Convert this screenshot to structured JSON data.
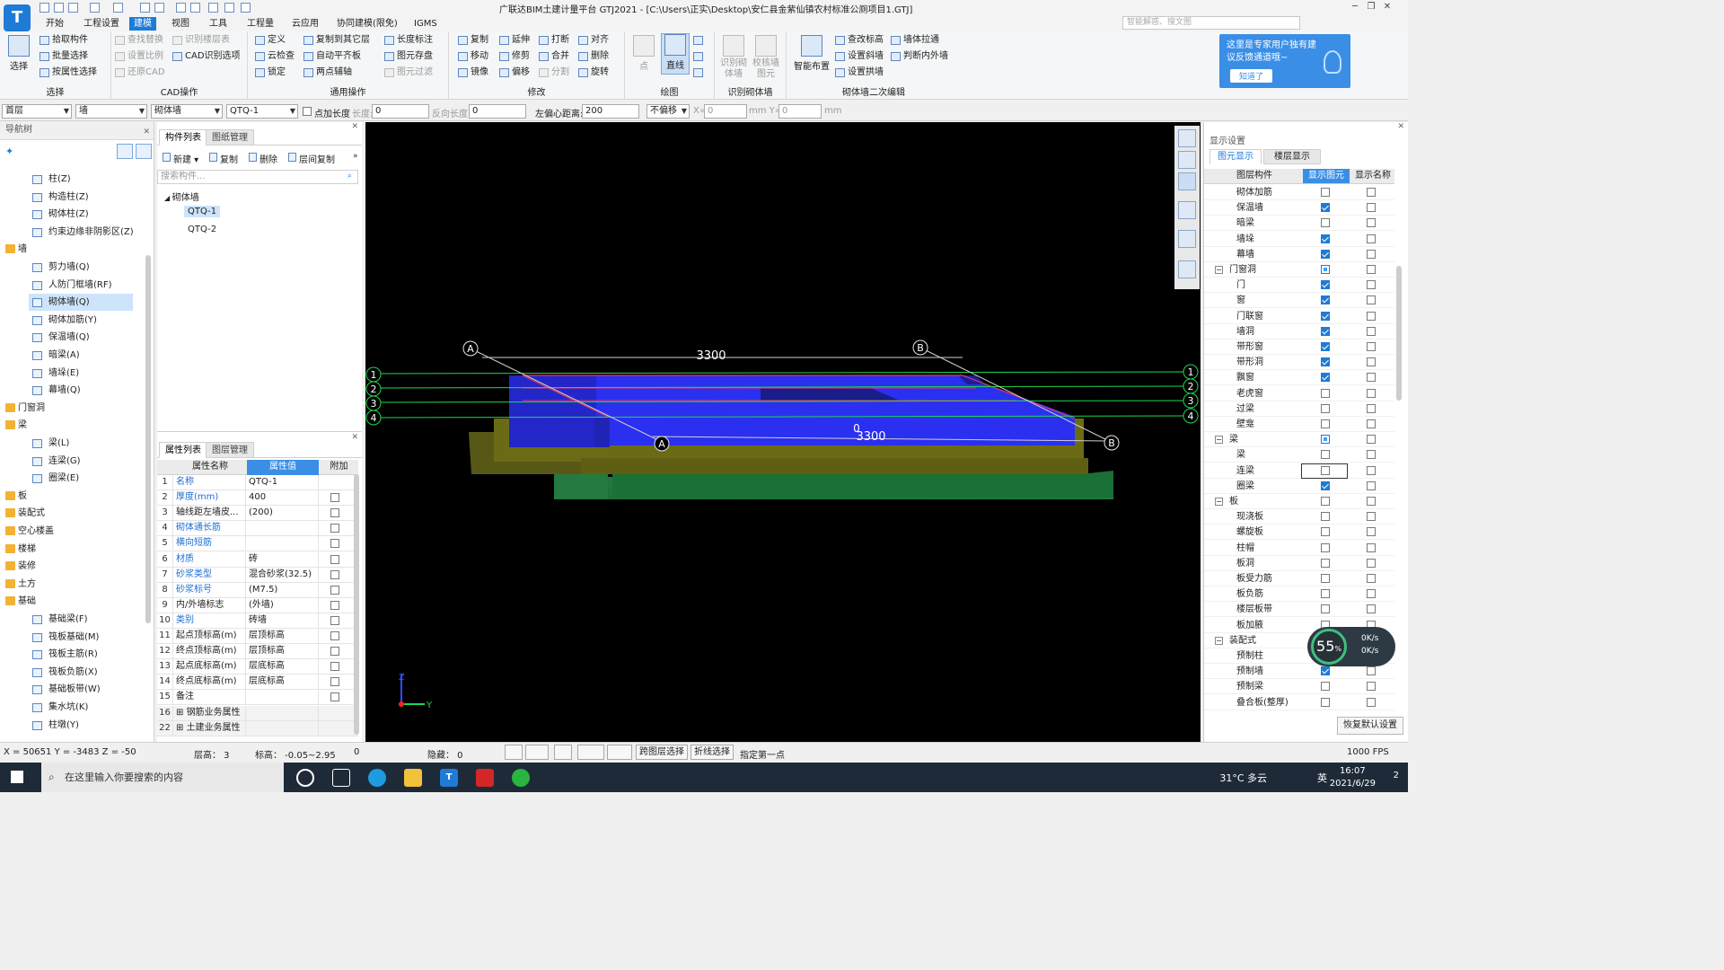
{
  "title": "广联达BIM土建计量平台 GTJ2021 - [C:\\Users\\正实\\Desktop\\安仁县金紫仙镇农村标准公厕项目1.GTJ]",
  "logo": "T",
  "menu": [
    "开始",
    "工程设置",
    "建模",
    "视图",
    "工具",
    "工程量",
    "云应用",
    "协同建模(限免)",
    "IGMS"
  ],
  "search_placeholder": "智能解惑、搜文图",
  "ribbon": {
    "select": {
      "big": "选择",
      "items": [
        "拾取构件",
        "批量选择",
        "按属性选择"
      ],
      "label": "选择"
    },
    "cad": {
      "items": [
        "查找替换",
        "设置比例",
        "还原CAD",
        "识别楼层表",
        "CAD识别选项"
      ],
      "label": "CAD操作"
    },
    "general": {
      "items": [
        "定义",
        "云检查",
        "锁定",
        "复制到其它层",
        "自动平齐板",
        "两点辅轴",
        "长度标注",
        "图元存盘",
        "图元过滤"
      ],
      "label": "通用操作"
    },
    "modify": {
      "items": [
        "复制",
        "移动",
        "镜像",
        "延伸",
        "修剪",
        "偏移",
        "打断",
        "合并",
        "分割",
        "对齐",
        "删除",
        "旋转"
      ],
      "label": "修改"
    },
    "draw": {
      "items": [
        "点",
        "直线"
      ],
      "label": "绘图"
    },
    "recognize": {
      "items": [
        "识别砌体墙",
        "校核墙图元"
      ],
      "label": "识别砌体墙"
    },
    "second_edit": {
      "items": [
        "智能布置",
        "查改标高",
        "设置斜墙",
        "设置拱墙",
        "墙体拉通",
        "判断内外墙"
      ],
      "label": "砌体墙二次编辑"
    }
  },
  "tip": {
    "text": "这里是专家用户独有建议反馈通道哦~",
    "button": "知道了"
  },
  "toolbar2": {
    "floor": "首层",
    "category": "墙",
    "type": "砌体墙",
    "component": "QTQ-1",
    "add_length_label": "点加长度",
    "length_label": "长度:",
    "length_value": "0",
    "reverse_label": "反向长度:",
    "reverse_value": "0",
    "offset_label": "左偏心距离:",
    "offset_value": "200",
    "mode": "不偏移",
    "x_label": "X=",
    "x_value": "0",
    "mm_y": "mm Y=",
    "y_value": "0",
    "mm": "mm"
  },
  "nav": {
    "title": "导航树",
    "rows": [
      {
        "label": "柱(Z)",
        "group": false
      },
      {
        "label": "构造柱(Z)",
        "group": false
      },
      {
        "label": "砌体柱(Z)",
        "group": false
      },
      {
        "label": "约束边缘非阴影区(Z)",
        "group": false
      },
      {
        "label": "墙",
        "group": true
      },
      {
        "label": "剪力墙(Q)",
        "group": false
      },
      {
        "label": "人防门框墙(RF)",
        "group": false
      },
      {
        "label": "砌体墙(Q)",
        "group": false,
        "selected": true
      },
      {
        "label": "砌体加筋(Y)",
        "group": false
      },
      {
        "label": "保温墙(Q)",
        "group": false
      },
      {
        "label": "暗梁(A)",
        "group": false
      },
      {
        "label": "墙垛(E)",
        "group": false
      },
      {
        "label": "幕墙(Q)",
        "group": false
      },
      {
        "label": "门窗洞",
        "group": true
      },
      {
        "label": "梁",
        "group": true
      },
      {
        "label": "梁(L)",
        "group": false
      },
      {
        "label": "连梁(G)",
        "group": false
      },
      {
        "label": "圈梁(E)",
        "group": false
      },
      {
        "label": "板",
        "group": true
      },
      {
        "label": "装配式",
        "group": true
      },
      {
        "label": "空心楼盖",
        "group": true
      },
      {
        "label": "楼梯",
        "group": true
      },
      {
        "label": "装修",
        "group": true
      },
      {
        "label": "土方",
        "group": true
      },
      {
        "label": "基础",
        "group": true
      },
      {
        "label": "基础梁(F)",
        "group": false
      },
      {
        "label": "筏板基础(M)",
        "group": false
      },
      {
        "label": "筏板主筋(R)",
        "group": false
      },
      {
        "label": "筏板负筋(X)",
        "group": false
      },
      {
        "label": "基础板带(W)",
        "group": false
      },
      {
        "label": "集水坑(K)",
        "group": false
      },
      {
        "label": "柱墩(Y)",
        "group": false
      }
    ]
  },
  "component_list": {
    "tabs": [
      "构件列表",
      "图纸管理"
    ],
    "toolbar": [
      "新建",
      "复制",
      "删除",
      "层间复制"
    ],
    "search_placeholder": "搜索构件...",
    "root": "砌体墙",
    "items": [
      "QTQ-1",
      "QTQ-2"
    ]
  },
  "property_list": {
    "tabs": [
      "属性列表",
      "图层管理"
    ],
    "headers": [
      "属性名称",
      "属性值",
      "附加"
    ],
    "rows": [
      {
        "idx": "1",
        "name": "名称",
        "value": "QTQ-1",
        "blue": true,
        "check": false
      },
      {
        "idx": "2",
        "name": "厚度(mm)",
        "value": "400",
        "blue": true,
        "check": true
      },
      {
        "idx": "3",
        "name": "轴线距左墙皮...",
        "value": "(200)",
        "blue": false,
        "check": true
      },
      {
        "idx": "4",
        "name": "砌体通长筋",
        "value": "",
        "blue": true,
        "check": true
      },
      {
        "idx": "5",
        "name": "横向短筋",
        "value": "",
        "blue": true,
        "check": true
      },
      {
        "idx": "6",
        "name": "材质",
        "value": "砖",
        "blue": true,
        "check": true
      },
      {
        "idx": "7",
        "name": "砂浆类型",
        "value": "混合砂浆(32.5)",
        "blue": true,
        "check": true
      },
      {
        "idx": "8",
        "name": "砂浆标号",
        "value": "(M7.5)",
        "blue": true,
        "check": true
      },
      {
        "idx": "9",
        "name": "内/外墙标志",
        "value": "(外墙)",
        "blue": false,
        "check": true
      },
      {
        "idx": "10",
        "name": "类别",
        "value": "砖墙",
        "blue": true,
        "check": true
      },
      {
        "idx": "11",
        "name": "起点顶标高(m)",
        "value": "层顶标高",
        "blue": false,
        "check": true
      },
      {
        "idx": "12",
        "name": "终点顶标高(m)",
        "value": "层顶标高",
        "blue": false,
        "check": true
      },
      {
        "idx": "13",
        "name": "起点底标高(m)",
        "value": "层底标高",
        "blue": false,
        "check": true
      },
      {
        "idx": "14",
        "name": "终点底标高(m)",
        "value": "层底标高",
        "blue": false,
        "check": true
      },
      {
        "idx": "15",
        "name": "备注",
        "value": "",
        "blue": false,
        "check": true
      },
      {
        "idx": "16",
        "name": "钢筋业务属性",
        "value": "",
        "blue": false,
        "check": false,
        "group": true
      },
      {
        "idx": "22",
        "name": "土建业务属性",
        "value": "",
        "blue": false,
        "check": false,
        "group": true
      }
    ]
  },
  "viewport": {
    "dim_top": "3300",
    "dim_bottom": "3300",
    "zero": "0",
    "axis_letters": [
      "A",
      "B",
      "A",
      "B"
    ],
    "axis_numbers": [
      "1",
      "2",
      "3",
      "4"
    ],
    "axis_x": "Y",
    "axis_z": "Z"
  },
  "display": {
    "title": "显示设置",
    "tabs": [
      "图元显示",
      "楼层显示"
    ],
    "headers": [
      "图层构件",
      "显示图元",
      "显示名称"
    ],
    "rows": [
      {
        "name": "砌体加筋",
        "level": 1,
        "show": "off",
        "name_show": false
      },
      {
        "name": "保温墙",
        "level": 1,
        "show": "on",
        "name_show": false
      },
      {
        "name": "暗梁",
        "level": 1,
        "show": "off",
        "name_show": false
      },
      {
        "name": "墙垛",
        "level": 1,
        "show": "on",
        "name_show": false
      },
      {
        "name": "幕墙",
        "level": 1,
        "show": "on",
        "name_show": false
      },
      {
        "name": "门窗洞",
        "level": 0,
        "show": "half",
        "name_show": false
      },
      {
        "name": "门",
        "level": 1,
        "show": "on",
        "name_show": false
      },
      {
        "name": "窗",
        "level": 1,
        "show": "on",
        "name_show": false
      },
      {
        "name": "门联窗",
        "level": 1,
        "show": "on",
        "name_show": false
      },
      {
        "name": "墙洞",
        "level": 1,
        "show": "on",
        "name_show": false
      },
      {
        "name": "带形窗",
        "level": 1,
        "show": "on",
        "name_show": false
      },
      {
        "name": "带形洞",
        "level": 1,
        "show": "on",
        "name_show": false
      },
      {
        "name": "飘窗",
        "level": 1,
        "show": "on",
        "name_show": false
      },
      {
        "name": "老虎窗",
        "level": 1,
        "show": "off",
        "name_show": false
      },
      {
        "name": "过梁",
        "level": 1,
        "show": "off",
        "name_show": false
      },
      {
        "name": "壁龛",
        "level": 1,
        "show": "off",
        "name_show": false
      },
      {
        "name": "梁",
        "level": 0,
        "show": "half",
        "name_show": false
      },
      {
        "name": "梁",
        "level": 1,
        "show": "off",
        "name_show": false
      },
      {
        "name": "连梁",
        "level": 1,
        "show": "off",
        "name_show": false,
        "selected": true
      },
      {
        "name": "圈梁",
        "level": 1,
        "show": "on",
        "name_show": false
      },
      {
        "name": "板",
        "level": 0,
        "show": "off",
        "name_show": false
      },
      {
        "name": "现浇板",
        "level": 1,
        "show": "off",
        "name_show": false
      },
      {
        "name": "螺旋板",
        "level": 1,
        "show": "off",
        "name_show": false
      },
      {
        "name": "柱帽",
        "level": 1,
        "show": "off",
        "name_show": false
      },
      {
        "name": "板洞",
        "level": 1,
        "show": "off",
        "name_show": false
      },
      {
        "name": "板受力筋",
        "level": 1,
        "show": "off",
        "name_show": false
      },
      {
        "name": "板负筋",
        "level": 1,
        "show": "off",
        "name_show": false
      },
      {
        "name": "楼层板带",
        "level": 1,
        "show": "off",
        "name_show": false
      },
      {
        "name": "板加腋",
        "level": 1,
        "show": "off",
        "name_show": false
      },
      {
        "name": "装配式",
        "level": 0,
        "show": "off",
        "name_show": false
      },
      {
        "name": "预制柱",
        "level": 1,
        "show": "off",
        "name_show": false
      },
      {
        "name": "预制墙",
        "level": 1,
        "show": "on",
        "name_show": false
      },
      {
        "name": "预制梁",
        "level": 1,
        "show": "off",
        "name_show": false
      },
      {
        "name": "叠合板(整厚)",
        "level": 1,
        "show": "off",
        "name_show": false
      }
    ],
    "restore_button": "恢复默认设置"
  },
  "speed": {
    "percent": "55",
    "unit": "%",
    "up": "0K/s",
    "down": "0K/s"
  },
  "status": {
    "coords": "X = 50651 Y = -3483 Z = -50",
    "floor_height": "层高：  3",
    "elevation": "标高：  -0.05~2.95",
    "count": "0",
    "hidden": "隐藏：  0",
    "btn_cross_layer": "跨图层选择",
    "btn_polyline": "折线选择",
    "hint": "指定第一点",
    "fps": "1000 FPS"
  },
  "taskbar": {
    "search": "在这里输入你要搜索的内容",
    "weather": "31°C 多云",
    "ime": "英",
    "time": "16:07",
    "date": "2021/6/29",
    "notif": "2"
  },
  "colors": {
    "accent": "#1e7bd6",
    "wall_blue": "#2a2ff0",
    "foundation_olive": "#6b6b16",
    "base_green": "#1e7a3a",
    "axis_green": "#1fd84f"
  }
}
